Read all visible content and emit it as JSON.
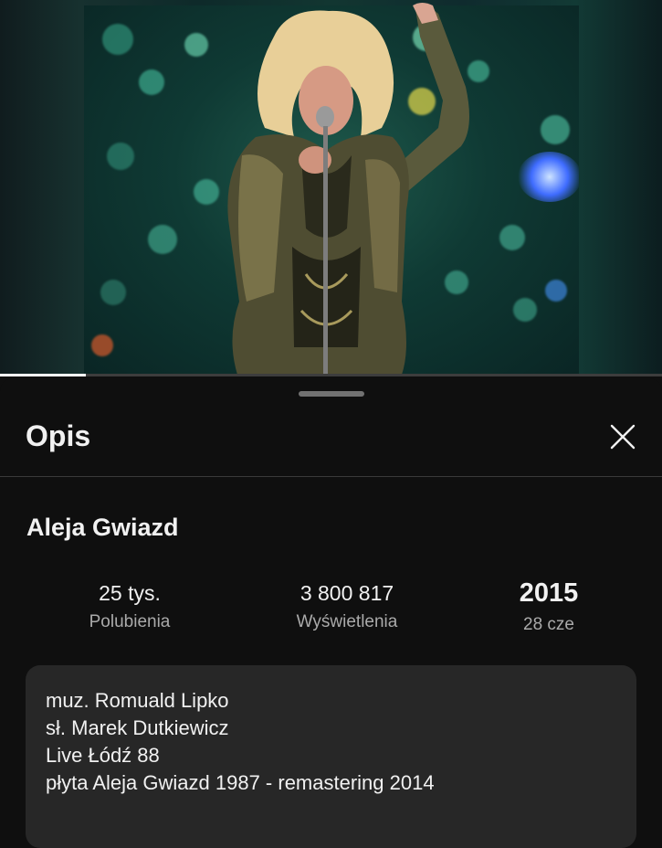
{
  "video": {
    "progress_fraction": 0.13
  },
  "sheet": {
    "title": "Opis",
    "close_icon": "close-icon"
  },
  "details": {
    "title": "Aleja Gwiazd",
    "stats": {
      "likes_value": "25 tys.",
      "likes_label": "Polubienia",
      "views_value": "3 800 817",
      "views_label": "Wyświetlenia",
      "year_value": "2015",
      "date_label": "28 cze"
    },
    "description": [
      "muz. Romuald Lipko",
      "sł. Marek Dutkiewicz",
      "Live Łódź 88",
      "płyta Aleja Gwiazd 1987 - remastering 2014"
    ]
  },
  "colors": {
    "background": "#0f0f0f",
    "card": "#272727",
    "text_primary": "#f1f1f1",
    "text_secondary": "#aaaaaa"
  }
}
